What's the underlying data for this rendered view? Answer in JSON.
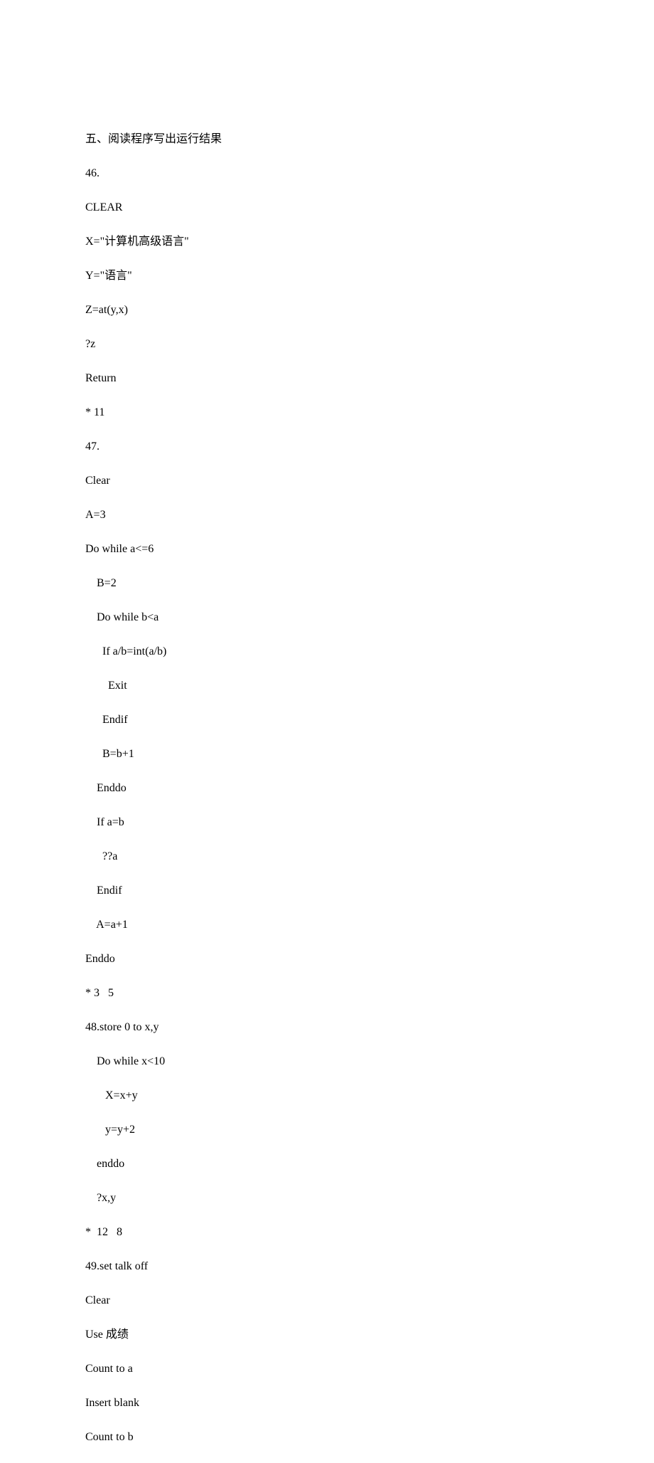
{
  "lines": [
    "五、阅读程序写出运行结果",
    "46.",
    "CLEAR",
    "X=\"计算机高级语言\"",
    "Y=\"语言\"",
    "Z=at(y,x)",
    "?z",
    "Return",
    "* 11",
    "47.",
    "Clear",
    "A=3",
    "Do while a<=6",
    "    B=2",
    "    Do while b<a",
    "      If a/b=int(a/b)",
    "        Exit",
    "      Endif",
    "      B=b+1",
    "    Enddo",
    "    If a=b",
    "      ??a",
    "    Endif",
    "    A=a+1",
    "Enddo",
    "* 3   5",
    "48.store 0 to x,y",
    "    Do while x<10",
    "       X=x+y",
    "       y=y+2",
    "    enddo",
    "    ?x,y",
    "*  12   8",
    "49.set talk off",
    "Clear",
    "Use 成绩",
    "Count to a",
    "Insert blank",
    "Count to b"
  ]
}
